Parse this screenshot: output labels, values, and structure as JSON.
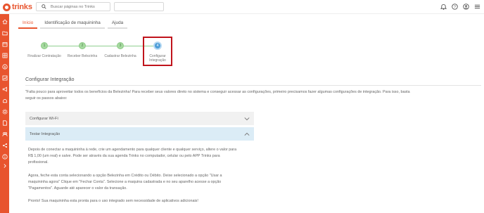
{
  "app": {
    "logo_text": "trinks",
    "brand_color": "#e8542e"
  },
  "header": {
    "search_placeholder": "Buscar páginas no Trinks",
    "icons": [
      "bell-icon",
      "help-icon",
      "user-icon",
      "menu-icon"
    ]
  },
  "sidebar": {
    "icons": [
      "home-icon",
      "folder-icon",
      "calendar-icon",
      "table-icon",
      "dollar-icon",
      "chart-icon",
      "megaphone-icon",
      "hand-icon",
      "gear-icon",
      "file-icon",
      "users-icon",
      "share-icon",
      "info-icon",
      "expand-icon"
    ]
  },
  "tabs": [
    {
      "label": "Início",
      "active": true
    },
    {
      "label": "Identificação de maquininha",
      "active": false
    },
    {
      "label": "Ajuda",
      "active": false
    }
  ],
  "stepper": {
    "steps": [
      {
        "number": "1",
        "label": "Finalizar Contratação"
      },
      {
        "number": "2",
        "label": "Receber Belezinha"
      },
      {
        "number": "3",
        "label": "Cadastrar Belezinha"
      },
      {
        "number": "4",
        "label_line1": "Configurar",
        "label_line2": "Integração"
      }
    ],
    "active_step": 4
  },
  "main": {
    "section_title": "Configurar Integração",
    "intro": "\"Falta pouco para aproveitar todos os benefícios da Belezinha! Para receber seus valores direto no sistema e conseguir acessar as configurações, primeiro precisamos fazer algumas configurações de integração. Para isso, basta seguir os passos abaixo:",
    "accordions": [
      {
        "label": "Configurar Wi-Fi",
        "expanded": false
      },
      {
        "label": "Testar Integração",
        "expanded": true
      }
    ],
    "paragraphs": [
      "Depois de conectar a maquininha à rede, crie um agendamento para qualquer cliente e qualquer serviço, altere o valor para R$ 1,00 (um real) e salve. Pode ser através da sua agenda Trinks no computador, celular ou pelo APP Trinks para profissional.",
      "Agora, feche esta conta selecionando a opção Belezinha em Crédito ou Débito. Deixe selecionado a opção \"Usar a maquininha agora\" Clique em \"Fechar Conta\". Selecione a maquina cadastrada e no seu aparelho acesse a opção \"Pagamentos\". Aguarde até aparecer o valor da transação.",
      "Pronto! Sua maquininha esta pronta para o uso integrado sem necessidade de aplicativos adicionais!"
    ]
  }
}
